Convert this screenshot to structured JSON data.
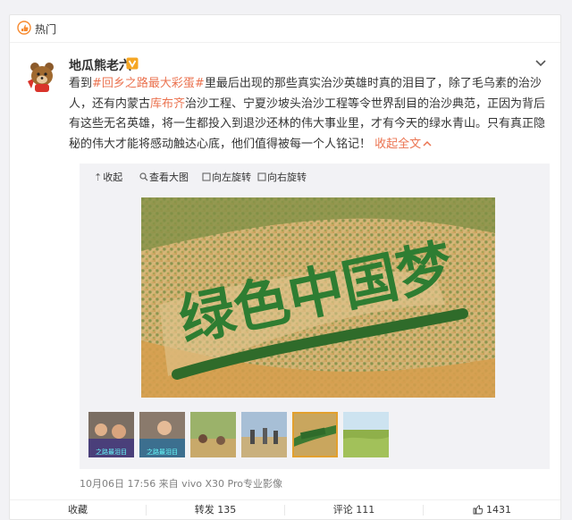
{
  "header": {
    "label": "热门"
  },
  "post": {
    "author": "地瓜熊老六",
    "text": {
      "p1": "看到",
      "hashtag1": "#回乡之路最大彩蛋#",
      "p2": "里最后出现的那些真实治沙英雄时真的泪目了，除了毛乌素的治沙人，还有内蒙古",
      "place": "库布齐",
      "p3": "治沙工程、宁夏沙坡头治沙工程等令世界刮目的治沙典范，正因为背后有这些无名英雄，将一生都投入到退沙还林的伟大事业里，才有今天的绿水青山。只有真正隐秘的伟大才能将感动触达心底，他们值得被每一个人铭记！",
      "collapse": "收起全文"
    },
    "toolbar": {
      "collapse": "收起",
      "view_large": "查看大图",
      "rotate_left": "向左旋转",
      "rotate_right": "向右旋转"
    },
    "image_text": "绿色中国梦",
    "thumb_captions": [
      "之路最泪目",
      "之路最泪目"
    ],
    "meta": "10月06日 17:56  来自 vivo X30 Pro专业影像",
    "actions": {
      "favorite": "收藏",
      "repost": "转发 135",
      "comment": "评论 111",
      "like": "1431"
    }
  },
  "colors": {
    "link": "#eb7350",
    "accent_border": "#e3a02e"
  }
}
